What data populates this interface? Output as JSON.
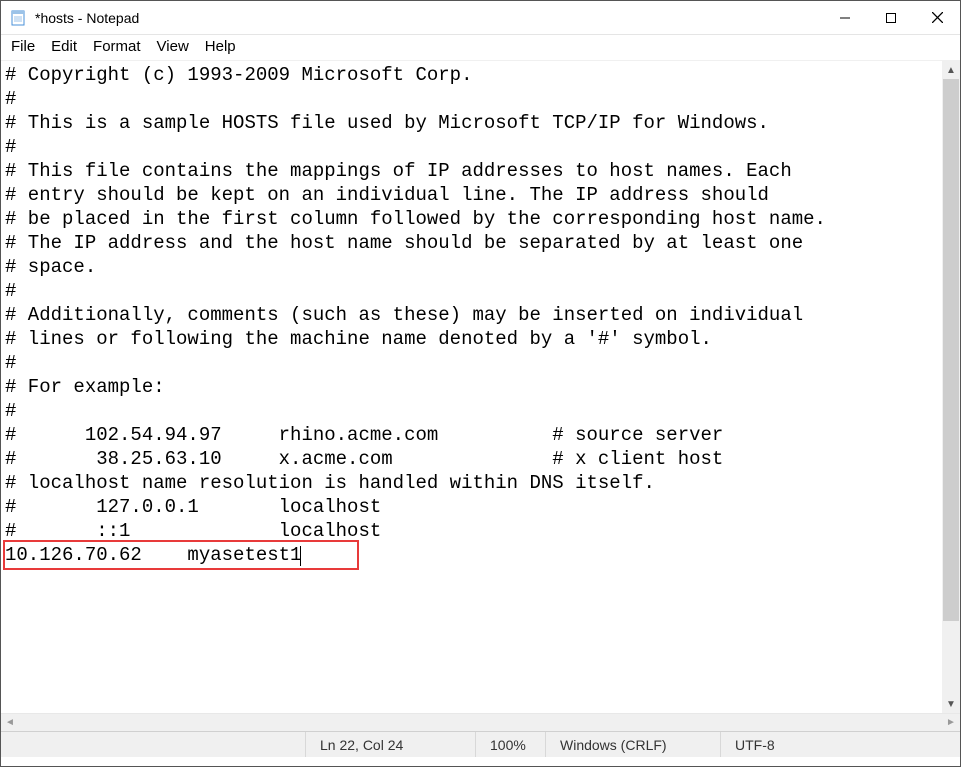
{
  "window": {
    "title": "*hosts - Notepad"
  },
  "menu": {
    "file": "File",
    "edit": "Edit",
    "format": "Format",
    "view": "View",
    "help": "Help"
  },
  "content": {
    "lines": [
      "# Copyright (c) 1993-2009 Microsoft Corp.",
      "#",
      "# This is a sample HOSTS file used by Microsoft TCP/IP for Windows.",
      "#",
      "# This file contains the mappings of IP addresses to host names. Each",
      "# entry should be kept on an individual line. The IP address should",
      "# be placed in the first column followed by the corresponding host name.",
      "# The IP address and the host name should be separated by at least one",
      "# space.",
      "#",
      "# Additionally, comments (such as these) may be inserted on individual",
      "# lines or following the machine name denoted by a '#' symbol.",
      "#",
      "# For example:",
      "#",
      "#      102.54.94.97     rhino.acme.com          # source server",
      "#       38.25.63.10     x.acme.com              # x client host",
      "",
      "# localhost name resolution is handled within DNS itself.",
      "#       127.0.0.1       localhost",
      "#       ::1             localhost",
      "10.126.70.62    myasetest1"
    ]
  },
  "status": {
    "cursor": "Ln 22, Col 24",
    "zoom": "100%",
    "line_ending": "Windows (CRLF)",
    "encoding": "UTF-8"
  },
  "annotation": {
    "highlight_line_index": 21
  }
}
